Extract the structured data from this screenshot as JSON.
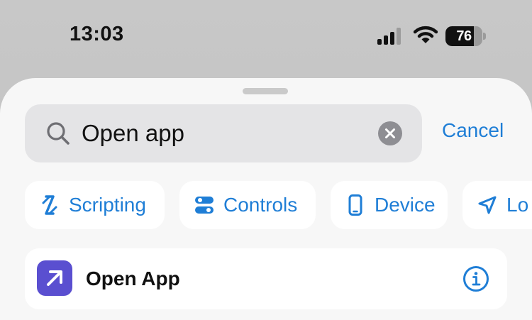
{
  "status_bar": {
    "time": "13:03",
    "battery_level": "76",
    "icons": [
      "cellular-signal-icon",
      "wifi-icon",
      "battery-icon"
    ]
  },
  "search": {
    "query": "Open app",
    "cancel_label": "Cancel",
    "icons": [
      "search-icon",
      "clear-icon"
    ]
  },
  "categories": [
    {
      "label": "Scripting",
      "icon": "scripting-icon"
    },
    {
      "label": "Controls",
      "icon": "toggle-icon"
    },
    {
      "label": "Device",
      "icon": "phone-icon"
    },
    {
      "label": "Lo",
      "icon": "location-arrow-icon"
    }
  ],
  "results": [
    {
      "label": "Open App",
      "icon": "open-app-arrow-icon",
      "accessory_icon": "info-icon"
    }
  ],
  "colors": {
    "accent": "#1f7ed6",
    "app_icon_bg": "#5a4fd0",
    "sheet_bg": "#f7f7f7",
    "search_field_bg": "#e4e4e6"
  }
}
